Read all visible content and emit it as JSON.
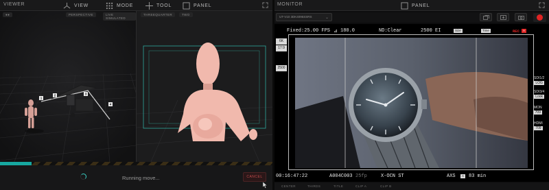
{
  "viewer": {
    "title": "VIEWER",
    "menus": [
      {
        "label": "VIEW",
        "icon": "camera-rig-icon"
      },
      {
        "label": "MODE",
        "icon": "grid-icon"
      },
      {
        "label": "TOOL",
        "icon": "crosshair-icon"
      },
      {
        "label": "PANEL",
        "icon": "panel-icon"
      }
    ],
    "view_labels": [
      "PERSPECTIVE",
      "LIVE SIMULATED",
      "THREEQUARTER",
      "TWO"
    ],
    "rig_markers": [
      "1",
      "2",
      "3",
      "4"
    ],
    "status_text": "Running move...",
    "cancel_label": "CANCEL"
  },
  "monitor": {
    "title": "MONITOR",
    "panel_label": "PANEL",
    "camera_select": "UT-V10 3DK4095SSRS",
    "osd": {
      "fps": "Fixed:25.00 FPS",
      "shutter": "180.0",
      "nd": "ND:Clear",
      "iso": "2500 EI",
      "size_label": "Size",
      "time_label": "Time",
      "rec": "REC",
      "rec_mark": "A",
      "left_boxes": [
        "6K",
        "17:9",
        "2500"
      ],
      "side_info": [
        {
          "label": "SDI1/2",
          "value": "LOG"
        },
        {
          "label": "SDI3/4",
          "value": "Look"
        },
        {
          "label": "MON",
          "value": "709"
        },
        {
          "label": "HDMI",
          "value": "709"
        }
      ],
      "timecode": "00:16:47:22",
      "clip": "A004C003",
      "fps_bottom": "25fp",
      "look": "X-OCN ST",
      "codec": "AXS",
      "codec_mark": "A",
      "remaining": "83 min"
    },
    "ticker": [
      "CENTER",
      "THIRDS",
      "TITLE",
      "CLIP A",
      "CLIP B"
    ]
  },
  "colors": {
    "accent": "#17a8a0",
    "rec_red": "#e02424",
    "cancel_red": "#c04a4a"
  }
}
